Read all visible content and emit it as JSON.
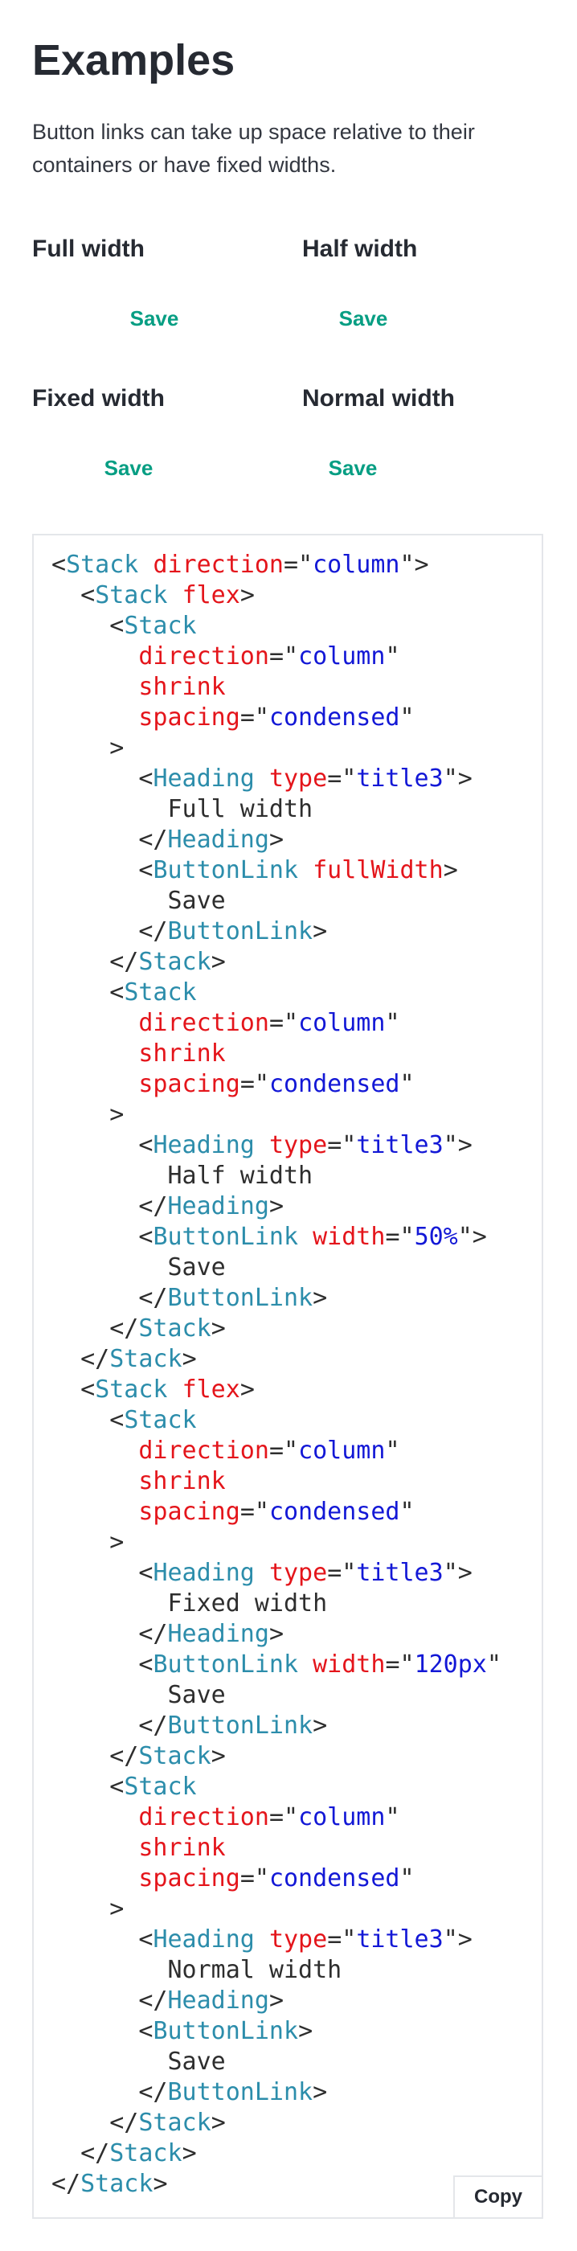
{
  "header": {
    "title": "Examples",
    "intro": "Button links can take up space relative to their containers or have fixed widths."
  },
  "examples": [
    {
      "heading": "Full width",
      "button_label": "Save"
    },
    {
      "heading": "Half width",
      "button_label": "Save"
    },
    {
      "heading": "Fixed width",
      "button_label": "Save"
    },
    {
      "heading": "Normal width",
      "button_label": "Save"
    }
  ],
  "code": {
    "copy_label": "Copy",
    "lines": [
      [
        [
          "p",
          "<"
        ],
        [
          "t",
          "Stack"
        ],
        [
          "p",
          " "
        ],
        [
          "a",
          "direction"
        ],
        [
          "p",
          "=\""
        ],
        [
          "s",
          "column"
        ],
        [
          "p",
          "\">"
        ]
      ],
      [
        [
          "p",
          "  <"
        ],
        [
          "t",
          "Stack"
        ],
        [
          "p",
          " "
        ],
        [
          "a",
          "flex"
        ],
        [
          "p",
          ">"
        ]
      ],
      [
        [
          "p",
          "    <"
        ],
        [
          "t",
          "Stack"
        ]
      ],
      [
        [
          "p",
          "      "
        ],
        [
          "a",
          "direction"
        ],
        [
          "p",
          "=\""
        ],
        [
          "s",
          "column"
        ],
        [
          "p",
          "\""
        ]
      ],
      [
        [
          "p",
          "      "
        ],
        [
          "a",
          "shrink"
        ]
      ],
      [
        [
          "p",
          "      "
        ],
        [
          "a",
          "spacing"
        ],
        [
          "p",
          "=\""
        ],
        [
          "s",
          "condensed"
        ],
        [
          "p",
          "\""
        ]
      ],
      [
        [
          "p",
          "    >"
        ]
      ],
      [
        [
          "p",
          "      <"
        ],
        [
          "t",
          "Heading"
        ],
        [
          "p",
          " "
        ],
        [
          "a",
          "type"
        ],
        [
          "p",
          "=\""
        ],
        [
          "s",
          "title3"
        ],
        [
          "p",
          "\">"
        ]
      ],
      [
        [
          "x",
          "        Full width"
        ]
      ],
      [
        [
          "p",
          "      </"
        ],
        [
          "t",
          "Heading"
        ],
        [
          "p",
          ">"
        ]
      ],
      [
        [
          "p",
          "      <"
        ],
        [
          "t",
          "ButtonLink"
        ],
        [
          "p",
          " "
        ],
        [
          "a",
          "fullWidth"
        ],
        [
          "p",
          ">"
        ]
      ],
      [
        [
          "x",
          "        Save"
        ]
      ],
      [
        [
          "p",
          "      </"
        ],
        [
          "t",
          "ButtonLink"
        ],
        [
          "p",
          ">"
        ]
      ],
      [
        [
          "p",
          "    </"
        ],
        [
          "t",
          "Stack"
        ],
        [
          "p",
          ">"
        ]
      ],
      [
        [
          "p",
          "    <"
        ],
        [
          "t",
          "Stack"
        ]
      ],
      [
        [
          "p",
          "      "
        ],
        [
          "a",
          "direction"
        ],
        [
          "p",
          "=\""
        ],
        [
          "s",
          "column"
        ],
        [
          "p",
          "\""
        ]
      ],
      [
        [
          "p",
          "      "
        ],
        [
          "a",
          "shrink"
        ]
      ],
      [
        [
          "p",
          "      "
        ],
        [
          "a",
          "spacing"
        ],
        [
          "p",
          "=\""
        ],
        [
          "s",
          "condensed"
        ],
        [
          "p",
          "\""
        ]
      ],
      [
        [
          "p",
          "    >"
        ]
      ],
      [
        [
          "p",
          "      <"
        ],
        [
          "t",
          "Heading"
        ],
        [
          "p",
          " "
        ],
        [
          "a",
          "type"
        ],
        [
          "p",
          "=\""
        ],
        [
          "s",
          "title3"
        ],
        [
          "p",
          "\">"
        ]
      ],
      [
        [
          "x",
          "        Half width"
        ]
      ],
      [
        [
          "p",
          "      </"
        ],
        [
          "t",
          "Heading"
        ],
        [
          "p",
          ">"
        ]
      ],
      [
        [
          "p",
          "      <"
        ],
        [
          "t",
          "ButtonLink"
        ],
        [
          "p",
          " "
        ],
        [
          "a",
          "width"
        ],
        [
          "p",
          "=\""
        ],
        [
          "s",
          "50%"
        ],
        [
          "p",
          "\">"
        ]
      ],
      [
        [
          "x",
          "        Save"
        ]
      ],
      [
        [
          "p",
          "      </"
        ],
        [
          "t",
          "ButtonLink"
        ],
        [
          "p",
          ">"
        ]
      ],
      [
        [
          "p",
          "    </"
        ],
        [
          "t",
          "Stack"
        ],
        [
          "p",
          ">"
        ]
      ],
      [
        [
          "p",
          "  </"
        ],
        [
          "t",
          "Stack"
        ],
        [
          "p",
          ">"
        ]
      ],
      [
        [
          "p",
          "  <"
        ],
        [
          "t",
          "Stack"
        ],
        [
          "p",
          " "
        ],
        [
          "a",
          "flex"
        ],
        [
          "p",
          ">"
        ]
      ],
      [
        [
          "p",
          "    <"
        ],
        [
          "t",
          "Stack"
        ]
      ],
      [
        [
          "p",
          "      "
        ],
        [
          "a",
          "direction"
        ],
        [
          "p",
          "=\""
        ],
        [
          "s",
          "column"
        ],
        [
          "p",
          "\""
        ]
      ],
      [
        [
          "p",
          "      "
        ],
        [
          "a",
          "shrink"
        ]
      ],
      [
        [
          "p",
          "      "
        ],
        [
          "a",
          "spacing"
        ],
        [
          "p",
          "=\""
        ],
        [
          "s",
          "condensed"
        ],
        [
          "p",
          "\""
        ]
      ],
      [
        [
          "p",
          "    >"
        ]
      ],
      [
        [
          "p",
          "      <"
        ],
        [
          "t",
          "Heading"
        ],
        [
          "p",
          " "
        ],
        [
          "a",
          "type"
        ],
        [
          "p",
          "=\""
        ],
        [
          "s",
          "title3"
        ],
        [
          "p",
          "\">"
        ]
      ],
      [
        [
          "x",
          "        Fixed width"
        ]
      ],
      [
        [
          "p",
          "      </"
        ],
        [
          "t",
          "Heading"
        ],
        [
          "p",
          ">"
        ]
      ],
      [
        [
          "p",
          "      <"
        ],
        [
          "t",
          "ButtonLink"
        ],
        [
          "p",
          " "
        ],
        [
          "a",
          "width"
        ],
        [
          "p",
          "=\""
        ],
        [
          "s",
          "120px"
        ],
        [
          "p",
          "\""
        ]
      ],
      [
        [
          "x",
          "        Save"
        ]
      ],
      [
        [
          "p",
          "      </"
        ],
        [
          "t",
          "ButtonLink"
        ],
        [
          "p",
          ">"
        ]
      ],
      [
        [
          "p",
          "    </"
        ],
        [
          "t",
          "Stack"
        ],
        [
          "p",
          ">"
        ]
      ],
      [
        [
          "p",
          "    <"
        ],
        [
          "t",
          "Stack"
        ]
      ],
      [
        [
          "p",
          "      "
        ],
        [
          "a",
          "direction"
        ],
        [
          "p",
          "=\""
        ],
        [
          "s",
          "column"
        ],
        [
          "p",
          "\""
        ]
      ],
      [
        [
          "p",
          "      "
        ],
        [
          "a",
          "shrink"
        ]
      ],
      [
        [
          "p",
          "      "
        ],
        [
          "a",
          "spacing"
        ],
        [
          "p",
          "=\""
        ],
        [
          "s",
          "condensed"
        ],
        [
          "p",
          "\""
        ]
      ],
      [
        [
          "p",
          "    >"
        ]
      ],
      [
        [
          "p",
          "      <"
        ],
        [
          "t",
          "Heading"
        ],
        [
          "p",
          " "
        ],
        [
          "a",
          "type"
        ],
        [
          "p",
          "=\""
        ],
        [
          "s",
          "title3"
        ],
        [
          "p",
          "\">"
        ]
      ],
      [
        [
          "x",
          "        Normal width"
        ]
      ],
      [
        [
          "p",
          "      </"
        ],
        [
          "t",
          "Heading"
        ],
        [
          "p",
          ">"
        ]
      ],
      [
        [
          "p",
          "      <"
        ],
        [
          "t",
          "ButtonLink"
        ],
        [
          "p",
          ">"
        ]
      ],
      [
        [
          "x",
          "        Save"
        ]
      ],
      [
        [
          "p",
          "      </"
        ],
        [
          "t",
          "ButtonLink"
        ],
        [
          "p",
          ">"
        ]
      ],
      [
        [
          "p",
          "    </"
        ],
        [
          "t",
          "Stack"
        ],
        [
          "p",
          ">"
        ]
      ],
      [
        [
          "p",
          "  </"
        ],
        [
          "t",
          "Stack"
        ],
        [
          "p",
          ">"
        ]
      ],
      [
        [
          "p",
          "</"
        ],
        [
          "t",
          "Stack"
        ],
        [
          "p",
          ">"
        ]
      ]
    ]
  }
}
